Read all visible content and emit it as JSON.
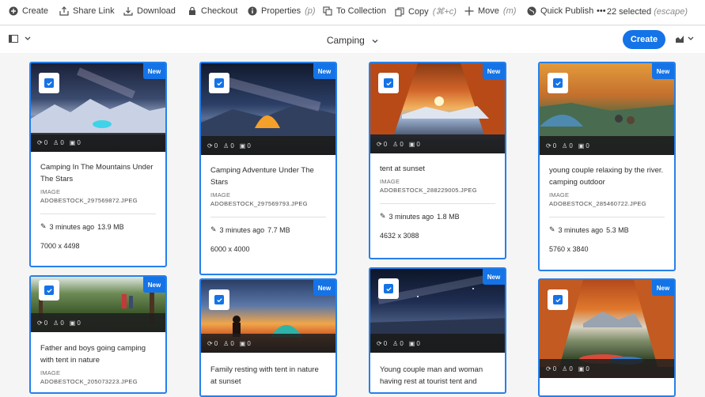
{
  "actionbar": {
    "items": [
      {
        "label": "Create",
        "icon": "add-circle-icon",
        "shortcut": ""
      },
      {
        "label": "Share Link",
        "icon": "share-icon",
        "shortcut": ""
      },
      {
        "label": "Download",
        "icon": "download-icon",
        "shortcut": ""
      },
      {
        "label": "Checkout",
        "icon": "lock-icon",
        "shortcut": ""
      },
      {
        "label": "Properties",
        "icon": "info-icon",
        "shortcut": "(p)"
      },
      {
        "label": "To Collection",
        "icon": "collection-icon",
        "shortcut": ""
      },
      {
        "label": "Copy",
        "icon": "copy-icon",
        "shortcut": "(⌘+c)"
      },
      {
        "label": "Move",
        "icon": "move-icon",
        "shortcut": "(m)"
      },
      {
        "label": "Quick Publish",
        "icon": "globe-icon",
        "shortcut": ""
      },
      {
        "label": "•••",
        "icon": "more-icon",
        "shortcut": ""
      }
    ],
    "selection": "22 selected",
    "selection_hint": "(escape)"
  },
  "toolbar": {
    "title": "Camping",
    "create_label": "Create"
  },
  "new_label": "New",
  "cards": [
    {
      "name": "Camping In The Mountains Under The Stars",
      "type": "IMAGE",
      "file": "ADOBESTOCK_297569872.JPEG",
      "modified": "3 minutes ago",
      "size": "13.9 MB",
      "dims": "7000 x 4498",
      "stats": [
        "0",
        "0",
        "0"
      ]
    },
    {
      "name": "Camping Adventure Under The Stars",
      "type": "IMAGE",
      "file": "ADOBESTOCK_297569793.JPEG",
      "modified": "3 minutes ago",
      "size": "7.7 MB",
      "dims": "6000 x 4000",
      "stats": [
        "0",
        "0",
        "0"
      ]
    },
    {
      "name": "tent at sunset",
      "type": "IMAGE",
      "file": "ADOBESTOCK_288229005.JPEG",
      "modified": "3 minutes ago",
      "size": "1.8 MB",
      "dims": "4632 x 3088",
      "stats": [
        "0",
        "0",
        "0"
      ]
    },
    {
      "name": "young couple relaxing by the river. camping outdoor",
      "type": "IMAGE",
      "file": "ADOBESTOCK_285460722.JPEG",
      "modified": "3 minutes ago",
      "size": "5.3 MB",
      "dims": "5760 x 3840",
      "stats": [
        "0",
        "0",
        "0"
      ]
    },
    {
      "name": "Father and boys going camping with tent in nature",
      "type": "IMAGE",
      "file": "ADOBESTOCK_205073223.JPEG",
      "modified": "",
      "size": "",
      "dims": "",
      "stats": [
        "0",
        "0",
        "0"
      ]
    },
    {
      "name": "Family resting with tent in nature at sunset",
      "type": "",
      "file": "",
      "modified": "",
      "size": "",
      "dims": "",
      "stats": [
        "0",
        "0",
        "0"
      ]
    },
    {
      "name": "Young couple man and woman having rest at tourist tent and",
      "type": "",
      "file": "",
      "modified": "",
      "size": "",
      "dims": "",
      "stats": [
        "0",
        "0",
        "0"
      ]
    },
    {
      "name": "",
      "type": "",
      "file": "",
      "modified": "",
      "size": "",
      "dims": "",
      "stats": [
        "0",
        "0",
        "0"
      ]
    }
  ]
}
